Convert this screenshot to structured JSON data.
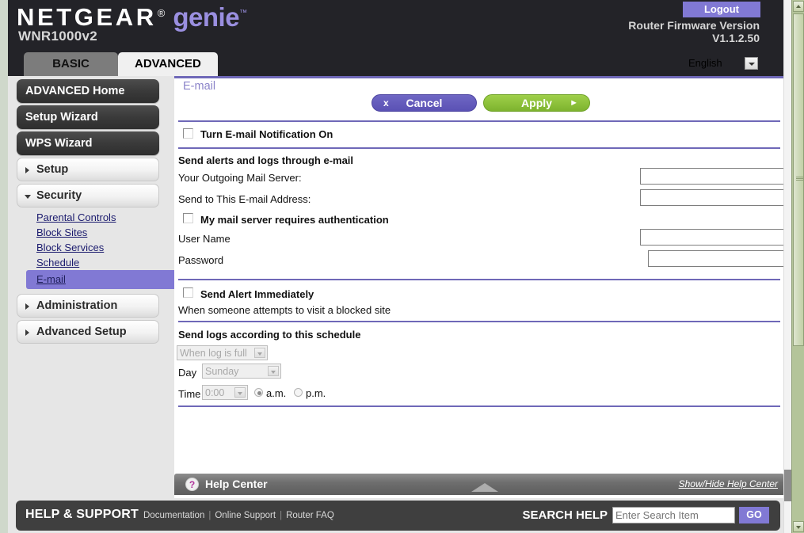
{
  "header": {
    "brand_netgear": "NETGEAR",
    "brand_reg": "®",
    "brand_genie": "genie",
    "brand_tm": "™",
    "model": "WNR1000v2",
    "logout_label": "Logout",
    "firmware_line1": "Router Firmware Version",
    "firmware_line2": "V1.1.2.50",
    "language_selected": "English"
  },
  "tabs": [
    {
      "label": "BASIC",
      "active": false
    },
    {
      "label": "ADVANCED",
      "active": true
    }
  ],
  "sidebar": {
    "buttons": [
      {
        "label": "ADVANCED Home"
      },
      {
        "label": "Setup Wizard"
      },
      {
        "label": "WPS Wizard"
      }
    ],
    "groups": [
      {
        "label": "Setup",
        "expanded": false
      },
      {
        "label": "Security",
        "expanded": true
      },
      {
        "label": "Administration",
        "expanded": false
      },
      {
        "label": "Advanced Setup",
        "expanded": false
      }
    ],
    "security_items": [
      {
        "label": "Parental Controls",
        "selected": false
      },
      {
        "label": "Block Sites",
        "selected": false
      },
      {
        "label": "Block Services",
        "selected": false
      },
      {
        "label": "Schedule",
        "selected": false
      },
      {
        "label": "E-mail",
        "selected": true
      }
    ]
  },
  "panel": {
    "title": "E-mail",
    "cancel_label": "Cancel",
    "cancel_icon": "x",
    "apply_label": "Apply",
    "apply_icon": "►",
    "notification_checkbox_label": "Turn E-mail Notification On",
    "notification_checked": false,
    "section_alerts_title": "Send alerts and logs through e-mail",
    "outgoing_server_label": "Your Outgoing Mail Server:",
    "outgoing_server_value": "",
    "email_address_label": "Send to This E-mail Address:",
    "email_address_value": "",
    "auth_checkbox_label": "My mail server requires authentication",
    "auth_checked": false,
    "username_label": "User Name",
    "username_value": "",
    "password_label": "Password",
    "password_value": "",
    "send_alert_label": "Send Alert Immediately",
    "send_alert_checked": false,
    "send_alert_sub": "When someone attempts to visit a blocked site",
    "schedule_title": "Send logs according to this schedule",
    "schedule_select_value": "When log is full",
    "day_label": "Day",
    "day_select_value": "Sunday",
    "time_label": "Time",
    "time_select_value": "0:00",
    "am_label": "a.m.",
    "pm_label": "p.m.",
    "meridiem_selected": "a.m."
  },
  "help_bar": {
    "icon": "?",
    "title": "Help Center",
    "show_hide_label": "Show/Hide Help Center"
  },
  "footer": {
    "title": "HELP & SUPPORT",
    "links": [
      "Documentation",
      "Online Support",
      "Router FAQ"
    ],
    "separator": "|",
    "search_label": "SEARCH HELP",
    "search_placeholder": "Enter Search Item",
    "search_value": "",
    "go_label": "GO"
  },
  "colors": {
    "accent_purple": "#8179d4",
    "apply_green": "#8ec43c",
    "header_dark": "#232328",
    "footer_dark": "#3f3f3f"
  }
}
